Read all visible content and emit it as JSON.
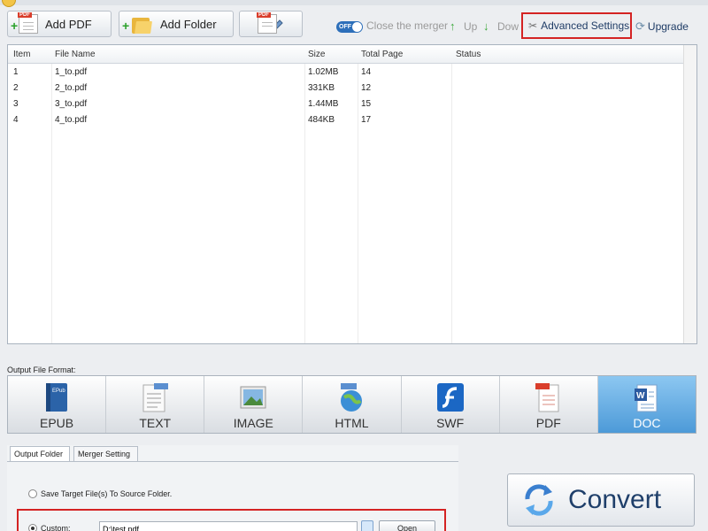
{
  "toolbar": {
    "add_pdf": "Add PDF",
    "add_folder": "Add Folder",
    "pdf_tag": "PDF",
    "toggle": "OFF",
    "close_merger": "Close the merger",
    "up": "Up",
    "down": "Dow",
    "advanced_settings": "Advanced Settings",
    "upgrade": "Upgrade",
    "up_arrow": "↑",
    "down_arrow": "↓"
  },
  "table": {
    "columns": [
      "Item",
      "File Name",
      "Size",
      "Total Page",
      "Status"
    ],
    "rows": [
      {
        "item": "1",
        "file": "1_to.pdf",
        "size": "1.02MB",
        "pages": "14",
        "status": ""
      },
      {
        "item": "2",
        "file": "2_to.pdf",
        "size": "331KB",
        "pages": "12",
        "status": ""
      },
      {
        "item": "3",
        "file": "3_to.pdf",
        "size": "1.44MB",
        "pages": "15",
        "status": ""
      },
      {
        "item": "4",
        "file": "4_to.pdf",
        "size": "484KB",
        "pages": "17",
        "status": ""
      }
    ]
  },
  "output": {
    "label": "Output File Format:",
    "formats": [
      "EPUB",
      "TEXT",
      "IMAGE",
      "HTML",
      "SWF",
      "PDF",
      "DOC"
    ],
    "selected": "DOC"
  },
  "settings": {
    "tabs": [
      "Output Folder",
      "Merger Setting"
    ],
    "save_to_source": "Save Target File(s) To Source Folder.",
    "custom": "Custom:",
    "path": "D:\\test pdf",
    "open": "Open"
  },
  "convert": "Convert",
  "icons": {
    "add_pdf": "pdf-document-icon",
    "add_folder": "folder-icon",
    "edit": "pdf-edit-icon",
    "advanced": "tools-icon",
    "upgrade": "upgrade-icon",
    "convert": "convert-arrows-icon"
  },
  "colors": {
    "accent": "#4d9ad8",
    "highlight": "#d42323"
  }
}
